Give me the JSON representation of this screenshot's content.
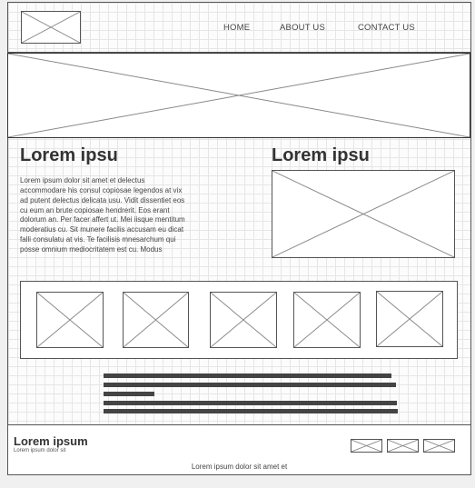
{
  "nav": {
    "items": [
      {
        "label": "HOME"
      },
      {
        "label": "ABOUT US"
      },
      {
        "label": "CONTACT US"
      }
    ]
  },
  "content": {
    "left_heading": "Lorem ipsu",
    "right_heading": "Lorem ipsu",
    "paragraph": "Lorem ipsum dolor sit amet et delectus accommodare his consul copiosae legendos at vix ad putent delectus delicata usu. Vidit dissentiet eos cu eum an brute copiosae hendrerit. Eos erant dolorum an. Per facer affert ut. Mei iisque mentitum moderatius cu. Sit munere facilis accusam eu dicat falli consulatu at vis. Te facilisis mnesarchum qui posse omnium mediocritatem est cu. Modus"
  },
  "footer": {
    "title": "Lorem ipsum",
    "subtitle": "Lorem ipsum dolor sit",
    "caption": "Lorem ipsum dolor sit amet et"
  }
}
